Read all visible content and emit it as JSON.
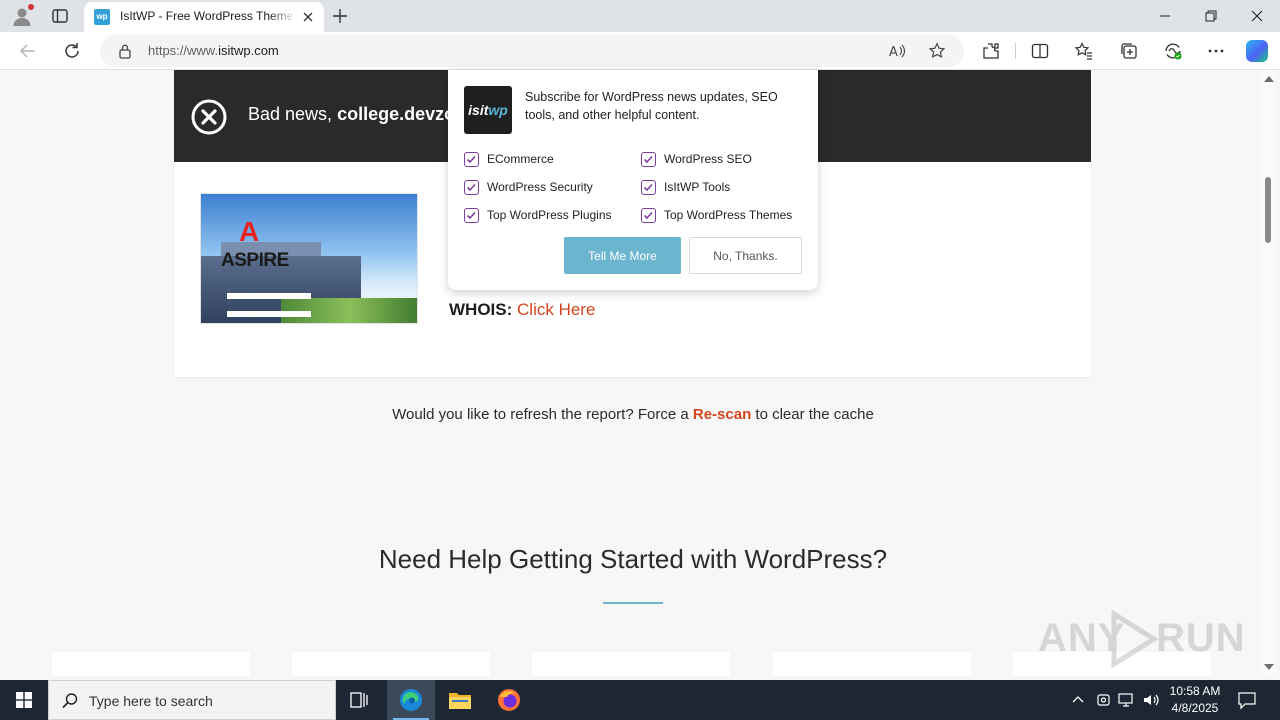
{
  "browser": {
    "tab_title": "IsItWP - Free WordPress Theme Detector",
    "tab_favicon_text": "wp",
    "url_prefix": "https://www.",
    "url_domain": "isitwp.com",
    "accent": "#0078d4"
  },
  "page": {
    "banner_prefix": "Bad news, ",
    "banner_domain": "college.devzo",
    "screenshot_text": "ASPIRE",
    "whois_label": "WHOIS:",
    "whois_link": "Click Here",
    "rescan_prefix": "Would you like to refresh the report? Force a ",
    "rescan_link": "Re-scan",
    "rescan_suffix": " to clear the cache",
    "help_heading": "Need Help Getting Started with WordPress?",
    "link_color": "#d2461f"
  },
  "popup": {
    "logo_text_a": "isit",
    "logo_text_b": "wp",
    "subscribe_text": "Subscribe for WordPress news updates, SEO tools, and other helpful content.",
    "options": [
      {
        "label": "ECommerce",
        "checked": true
      },
      {
        "label": "WordPress SEO",
        "checked": true
      },
      {
        "label": "WordPress Security",
        "checked": true
      },
      {
        "label": "IsItWP Tools",
        "checked": true
      },
      {
        "label": "Top WordPress Plugins",
        "checked": true
      },
      {
        "label": "Top WordPress Themes",
        "checked": true
      }
    ],
    "primary_button": "Tell Me More",
    "secondary_button": "No, Thanks.",
    "primary_color": "#6cb5cf",
    "check_color": "#7b3fa0"
  },
  "watermark": {
    "text_left": "ANY",
    "text_right": "RUN"
  },
  "taskbar": {
    "search_placeholder": "Type here to search",
    "time": "10:58 AM",
    "date": "4/8/2025"
  }
}
